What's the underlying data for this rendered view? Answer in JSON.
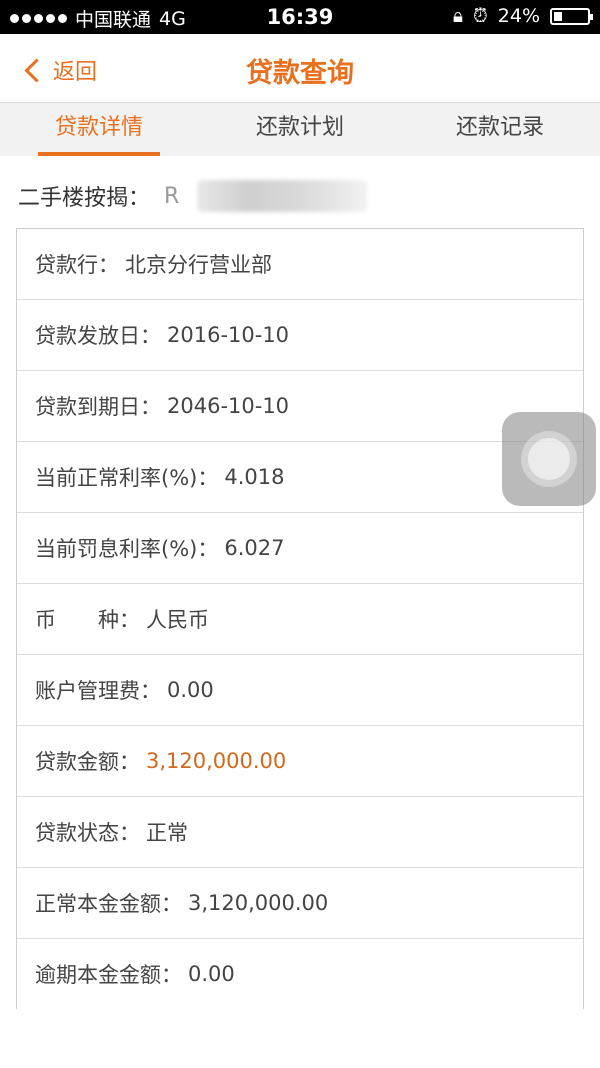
{
  "status_bar": {
    "carrier": "中国联通",
    "network": "4G",
    "time": "16:39",
    "battery": "24%",
    "battery_level": 0.24
  },
  "nav": {
    "back_label": "返回",
    "title": "贷款查询"
  },
  "tabs": [
    {
      "label": "贷款详情",
      "active": true
    },
    {
      "label": "还款计划",
      "active": false
    },
    {
      "label": "还款记录",
      "active": false
    }
  ],
  "loan_header": {
    "label": "二手楼按揭：",
    "masked_value": "R"
  },
  "details": [
    {
      "label": "贷款行：",
      "value": "北京分行营业部"
    },
    {
      "label": "贷款发放日：",
      "value": "2016-10-10"
    },
    {
      "label": "贷款到期日：",
      "value": "2046-10-10"
    },
    {
      "label": "当前正常利率(%)：",
      "value": "4.018"
    },
    {
      "label": "当前罚息利率(%)：",
      "value": "6.027"
    },
    {
      "label": "币　　种：",
      "value": "人民币"
    },
    {
      "label": "账户管理费：",
      "value": "0.00"
    },
    {
      "label": "贷款金额：",
      "value": "3,120,000.00",
      "highlight": true
    },
    {
      "label": "贷款状态：",
      "value": "正常"
    },
    {
      "label": "正常本金金额：",
      "value": "3,120,000.00"
    },
    {
      "label": "逾期本金金额：",
      "value": "0.00"
    }
  ],
  "colors": {
    "accent": "#e8701f",
    "highlight_value": "#d2691e"
  }
}
